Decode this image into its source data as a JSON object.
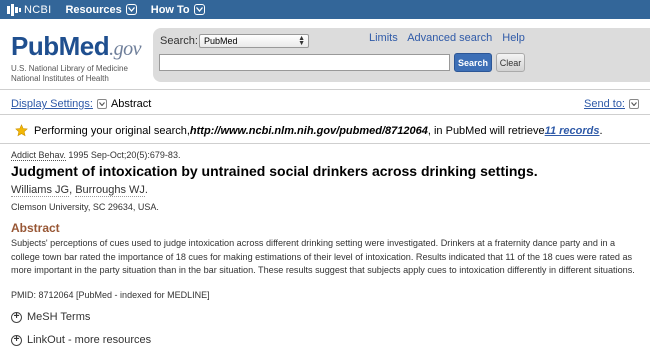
{
  "ncbi_bar": {
    "logo_text": "NCBI",
    "nav": [
      {
        "label": "Resources"
      },
      {
        "label": "How To"
      }
    ]
  },
  "header": {
    "logo_pub": "Pub",
    "logo_med": "Med",
    "logo_gov": ".gov",
    "sub1": "U.S. National Library of Medicine",
    "sub2": "National Institutes of Health",
    "search_label": "Search:",
    "db_selected": "PubMed",
    "links": [
      "Limits",
      "Advanced search",
      "Help"
    ],
    "search_value": "",
    "search_button": "Search",
    "clear_button": "Clear"
  },
  "display": {
    "settings_label": "Display Settings:",
    "format": "Abstract",
    "send_to": "Send to:"
  },
  "notice": {
    "prefix": "Performing your original search, ",
    "url": "http://www.ncbi.nlm.nih.gov/pubmed/8712064",
    "middle": ", in PubMed will retrieve ",
    "records_link": "11 records",
    "suffix": "."
  },
  "article": {
    "journal": "Addict Behav.",
    "citation_rest": " 1995 Sep-Oct;20(5):679-83.",
    "title": "Judgment of intoxication by untrained social drinkers across drinking settings.",
    "authors": [
      "Williams JG",
      "Burroughs WJ"
    ],
    "affiliation": "Clemson University, SC 29634, USA.",
    "abstract_heading": "Abstract",
    "abstract": "Subjects' perceptions of cues used to judge intoxication across different drinking setting were investigated. Drinkers at a fraternity dance party and in a college town bar rated the importance of 18 cues for making estimations of their level of intoxication. Results indicated that 11 of the 18 cues were rated as more important in the party situation than in the bar situation. These results suggest that subjects apply cues to intoxication differently in different situations.",
    "pmid": "PMID: 8712064 [PubMed - indexed for MEDLINE]"
  },
  "sections": [
    {
      "label": "MeSH Terms"
    },
    {
      "label": "LinkOut - more resources"
    }
  ],
  "colors": {
    "ncbi_bar": "#336699",
    "link": "#2f5aa8",
    "abstract_heading": "#985735",
    "search_button": "#3d6fb6"
  }
}
